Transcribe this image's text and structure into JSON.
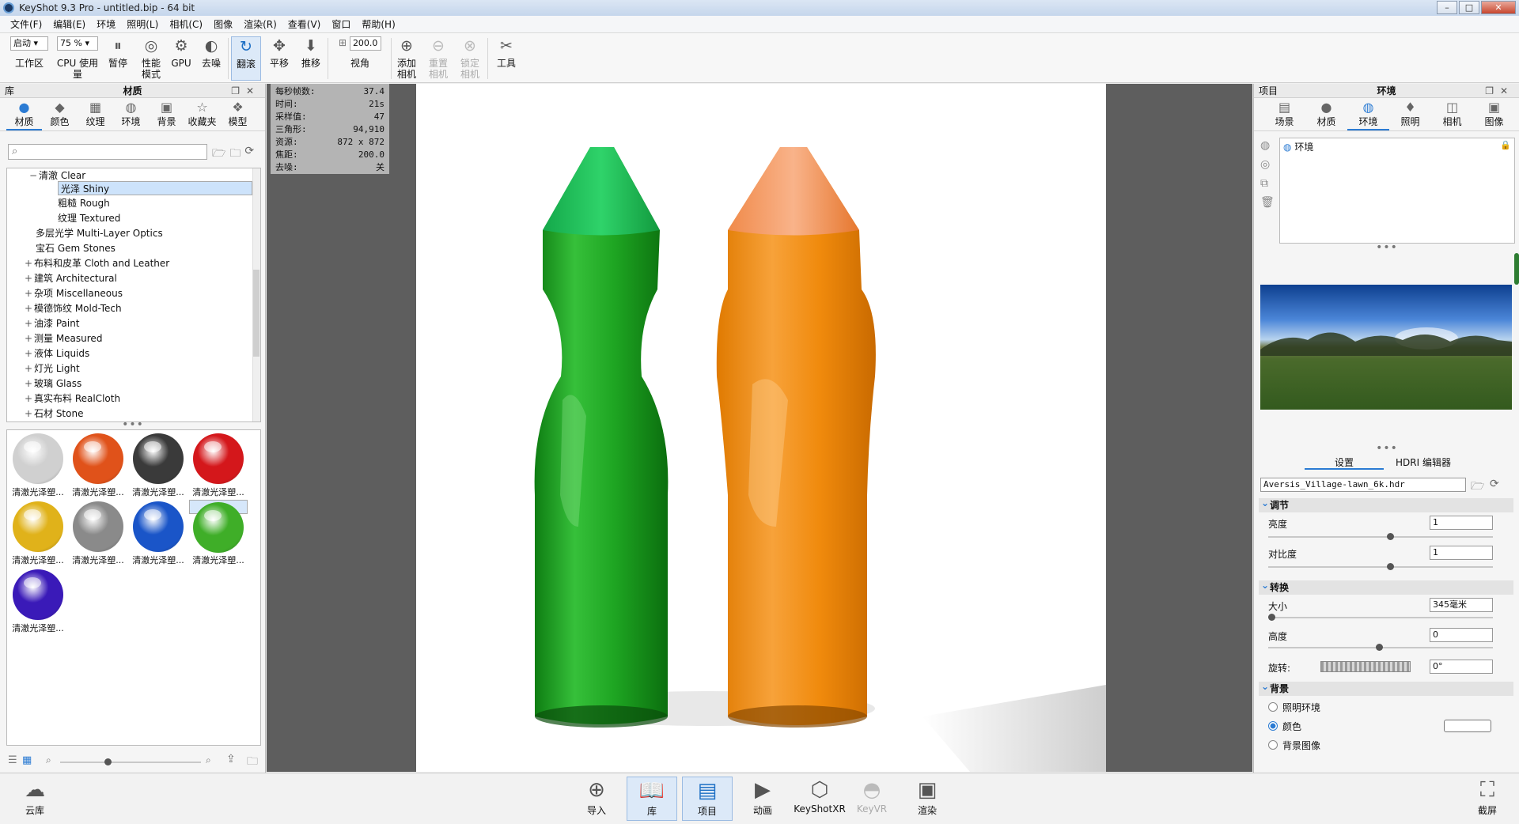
{
  "window": {
    "title": "KeyShot 9.3 Pro  - untitled.bip  - 64 bit",
    "min": "–",
    "max": "□",
    "close": "✕"
  },
  "menu": [
    "文件(F)",
    "编辑(E)",
    "环境",
    "照明(L)",
    "相机(C)",
    "图像",
    "渲染(R)",
    "查看(V)",
    "窗口",
    "帮助(H)"
  ],
  "toolbar": {
    "workspace_select": "启动",
    "workspace_label": "工作区",
    "cpu_select": "75 %",
    "cpu_label": "CPU 使用量",
    "pause": "暂停",
    "perf_mode": "性能模式",
    "gpu": "GPU",
    "denoise": "去噪",
    "tumble": "翻滚",
    "pan": "平移",
    "dolly": "推移",
    "fov_value": "200.0",
    "fov_label": "视角",
    "add_camera": "添加相机",
    "reset_camera": "重置相机",
    "lock_camera": "锁定相机",
    "tools": "工具"
  },
  "left": {
    "header_left": "库",
    "header_title": "材质",
    "tabs": [
      "材质",
      "颜色",
      "纹理",
      "环境",
      "背景",
      "收藏夹",
      "模型"
    ],
    "tree": [
      {
        "label": "清澈 Clear",
        "exp": "−"
      },
      {
        "label": "光泽 Shiny",
        "exp": ""
      },
      {
        "label": "粗糙 Rough",
        "exp": ""
      },
      {
        "label": "纹理 Textured",
        "exp": ""
      },
      {
        "label": "多层光学 Multi-Layer Optics",
        "exp": ""
      },
      {
        "label": "宝石 Gem Stones",
        "exp": ""
      },
      {
        "label": "布料和皮革 Cloth and Leather",
        "exp": "+"
      },
      {
        "label": "建筑 Architectural",
        "exp": "+"
      },
      {
        "label": "杂项 Miscellaneous",
        "exp": "+"
      },
      {
        "label": "模德饰纹 Mold-Tech",
        "exp": "+"
      },
      {
        "label": "油漆 Paint",
        "exp": "+"
      },
      {
        "label": "测量 Measured",
        "exp": "+"
      },
      {
        "label": "液体 Liquids",
        "exp": "+"
      },
      {
        "label": "灯光 Light",
        "exp": "+"
      },
      {
        "label": "玻璃 Glass",
        "exp": "+"
      },
      {
        "label": "真实布料 RealCloth",
        "exp": "+"
      },
      {
        "label": "石材 Stone",
        "exp": "+"
      }
    ],
    "thumbnails": [
      {
        "label": "清澈光泽塑...",
        "color": "#d0d0d0"
      },
      {
        "label": "清澈光泽塑...",
        "color": "#e0521a"
      },
      {
        "label": "清澈光泽塑...",
        "color": "#3a3a3a"
      },
      {
        "label": "清澈光泽塑...",
        "color": "#d4171b"
      },
      {
        "label": "清澈光泽塑...",
        "color": "#e0b21a"
      },
      {
        "label": "清澈光泽塑...",
        "color": "#8a8a8a"
      },
      {
        "label": "清澈光泽塑...",
        "color": "#1a55c8"
      },
      {
        "label": "清澈光泽塑...",
        "color": "#3fae28"
      },
      {
        "label": "清澈光泽塑...",
        "color": "#3a1ab8"
      }
    ]
  },
  "info": [
    {
      "k": "每秒帧数:",
      "v": "37.4"
    },
    {
      "k": "时间:",
      "v": "21s"
    },
    {
      "k": "采样值:",
      "v": "47"
    },
    {
      "k": "三角形:",
      "v": "94,910"
    },
    {
      "k": "资源:",
      "v": "872 x 872"
    },
    {
      "k": "焦距:",
      "v": "200.0"
    },
    {
      "k": "去噪:",
      "v": "关"
    }
  ],
  "right": {
    "header_left": "项目",
    "header_title": "环境",
    "tabs": [
      "场景",
      "材质",
      "环境",
      "照明",
      "相机",
      "图像"
    ],
    "env_item": "环境",
    "subtabs": [
      "设置",
      "HDRI 编辑器"
    ],
    "hdri_file": "Aversis_Village-lawn_6k.hdr",
    "sections": {
      "adjust": "调节",
      "transform": "转换",
      "background": "背景"
    },
    "brightness_label": "亮度",
    "brightness_value": "1",
    "contrast_label": "对比度",
    "contrast_value": "1",
    "size_label": "大小",
    "size_value": "345毫米",
    "height_label": "高度",
    "height_value": "0",
    "rotation_label": "旋转:",
    "rotation_value": "0°",
    "bg_options": [
      "照明环境",
      "颜色",
      "背景图像"
    ],
    "bg_color": "#ffffff"
  },
  "bottom": {
    "cloud": "云库",
    "import": "导入",
    "library": "库",
    "project": "项目",
    "animation": "动画",
    "keyshotxr": "KeyShotXR",
    "keyvr": "KeyVR",
    "render": "渲染",
    "screenshot": "截屏"
  },
  "colors": {
    "accent": "#2b7bd3",
    "bottle_green": "#1fa31f",
    "bottle_orange": "#f08a0c"
  }
}
